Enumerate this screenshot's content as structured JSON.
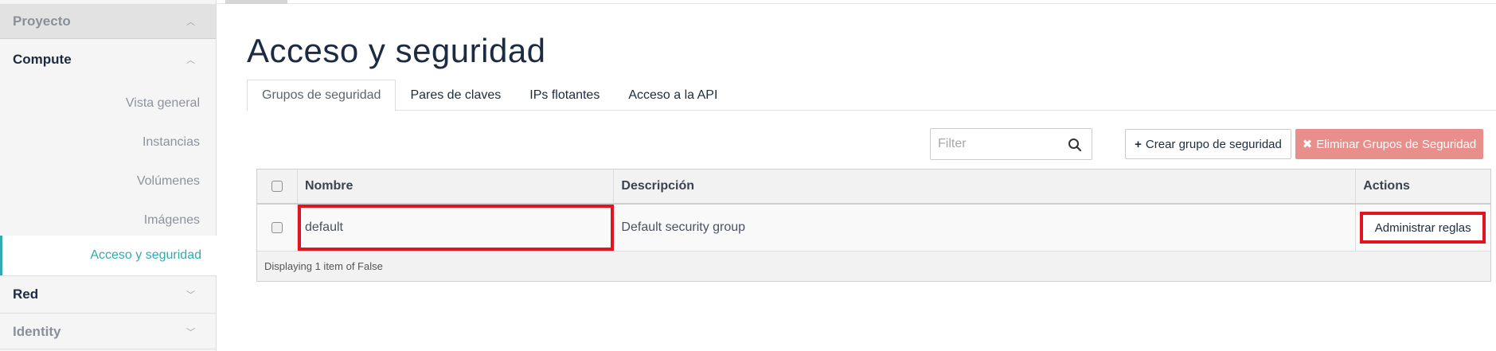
{
  "sidebar": {
    "proyecto": "Proyecto",
    "compute": "Compute",
    "items": [
      {
        "label": "Vista general"
      },
      {
        "label": "Instancias"
      },
      {
        "label": "Volúmenes"
      },
      {
        "label": "Imágenes"
      },
      {
        "label": "Acceso y seguridad"
      }
    ],
    "red": "Red",
    "identity": "Identity"
  },
  "page": {
    "title": "Acceso y seguridad"
  },
  "tabs": [
    {
      "label": "Grupos de seguridad"
    },
    {
      "label": "Pares de claves"
    },
    {
      "label": "IPs flotantes"
    },
    {
      "label": "Acceso a la API"
    }
  ],
  "toolbar": {
    "filter_placeholder": "Filter",
    "create_label": "Crear grupo de seguridad",
    "create_icon": "plus-icon",
    "delete_label": "Eliminar Grupos de Seguridad",
    "delete_icon": "times-icon",
    "delete_color": "#e88e8b"
  },
  "table": {
    "columns": [
      "Nombre",
      "Descripción",
      "Actions"
    ],
    "rows": [
      {
        "name": "default",
        "description": "Default security group",
        "action": "Administrar reglas"
      }
    ],
    "footer": "Displaying 1 item of False"
  },
  "colors": {
    "accent": "#33a9b1",
    "title": "#1c2b44",
    "highlight": "#e1141f"
  }
}
